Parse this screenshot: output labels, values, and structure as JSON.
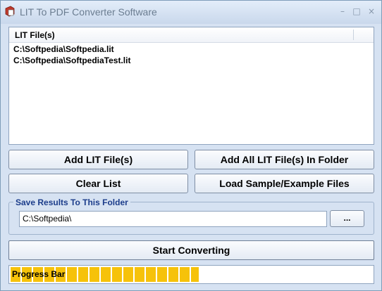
{
  "window": {
    "title": "LIT To PDF Converter Software",
    "controls": {
      "minimize": "–",
      "restore": "□",
      "close": "×"
    }
  },
  "file_list": {
    "column_header": "LIT File(s)",
    "items": [
      "C:\\Softpedia\\Softpedia.lit",
      "C:\\Softpedia\\SoftpediaTest.lit"
    ]
  },
  "buttons": {
    "add_files": "Add LIT File(s)",
    "add_folder": "Add All LIT File(s) In Folder",
    "clear_list": "Clear List",
    "load_samples": "Load Sample/Example Files",
    "browse": "...",
    "start": "Start Converting"
  },
  "output": {
    "group_label": "Save Results To This Folder",
    "folder_value": "C:\\Softpedia\\"
  },
  "progress": {
    "label": "Progress Bar",
    "fraction": 0.52
  },
  "icons": {
    "app": "lit-to-pdf-app-icon"
  },
  "colors": {
    "background": "#d6e2f2",
    "progress": "#f6c20a",
    "group_label": "#1c3d8b"
  }
}
